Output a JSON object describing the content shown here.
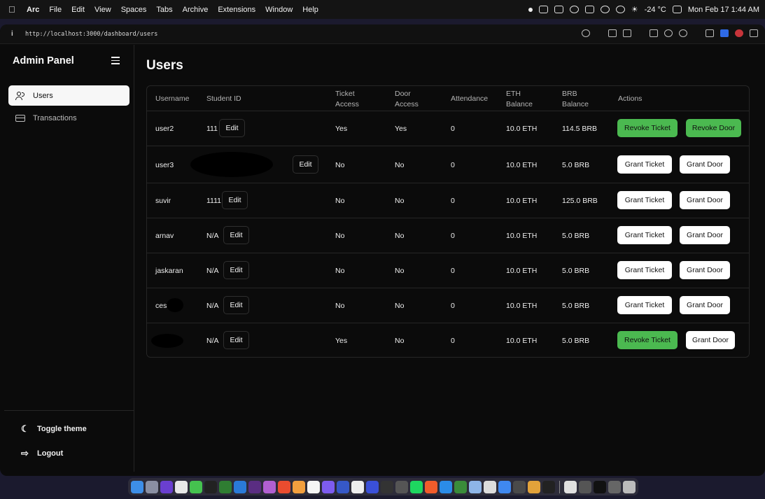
{
  "menubar": {
    "app_name": "Arc",
    "menus": [
      "File",
      "Edit",
      "View",
      "Spaces",
      "Tabs",
      "Archive",
      "Extensions",
      "Window",
      "Help"
    ],
    "weather": "-24 °C",
    "clock": "Mon Feb 17  1:44 AM"
  },
  "browser": {
    "url": "http://localhost:3000/dashboard/users"
  },
  "sidebar": {
    "title": "Admin Panel",
    "items": [
      {
        "label": "Users",
        "icon": "users-icon",
        "active": true
      },
      {
        "label": "Transactions",
        "icon": "credit-card-icon",
        "active": false
      }
    ],
    "footer": {
      "toggle_theme": "Toggle theme",
      "logout": "Logout"
    }
  },
  "main": {
    "title": "Users",
    "columns": {
      "username": "Username",
      "student_id": "Student ID",
      "ticket_access": "Ticket Access",
      "door_access": "Door Access",
      "attendance": "Attendance",
      "eth_balance": "ETH Balance",
      "brb_balance": "BRB Balance",
      "actions": "Actions"
    },
    "edit_label": "Edit",
    "rows": [
      {
        "username": "user2",
        "student_id": "111",
        "ticket": "Yes",
        "door": "Yes",
        "attendance": "0",
        "eth": "10.0 ETH",
        "brb": "114.5 BRB",
        "ticket_action": "Revoke Ticket",
        "door_action": "Revoke Door"
      },
      {
        "username": "user3",
        "student_id": "",
        "ticket": "No",
        "door": "No",
        "attendance": "0",
        "eth": "10.0 ETH",
        "brb": "5.0 BRB",
        "ticket_action": "Grant Ticket",
        "door_action": "Grant Door"
      },
      {
        "username": "suvir",
        "student_id": "1111",
        "ticket": "No",
        "door": "No",
        "attendance": "0",
        "eth": "10.0 ETH",
        "brb": "125.0 BRB",
        "ticket_action": "Grant Ticket",
        "door_action": "Grant Door"
      },
      {
        "username": "arnav",
        "student_id": "N/A",
        "ticket": "No",
        "door": "No",
        "attendance": "0",
        "eth": "10.0 ETH",
        "brb": "5.0 BRB",
        "ticket_action": "Grant Ticket",
        "door_action": "Grant Door"
      },
      {
        "username": "jaskaran",
        "student_id": "N/A",
        "ticket": "No",
        "door": "No",
        "attendance": "0",
        "eth": "10.0 ETH",
        "brb": "5.0 BRB",
        "ticket_action": "Grant Ticket",
        "door_action": "Grant Door"
      },
      {
        "username": "ces",
        "student_id": "N/A",
        "ticket": "No",
        "door": "No",
        "attendance": "0",
        "eth": "10.0 ETH",
        "brb": "5.0 BRB",
        "ticket_action": "Grant Ticket",
        "door_action": "Grant Door"
      },
      {
        "username": "",
        "student_id": "N/A",
        "ticket": "Yes",
        "door": "No",
        "attendance": "0",
        "eth": "10.0 ETH",
        "brb": "5.0 BRB",
        "ticket_action": "Revoke Ticket",
        "door_action": "Grant Door"
      }
    ]
  },
  "colors": {
    "revoke_button": "#4bb950",
    "grant_button": "#ffffff",
    "background": "#0b0b0b"
  }
}
